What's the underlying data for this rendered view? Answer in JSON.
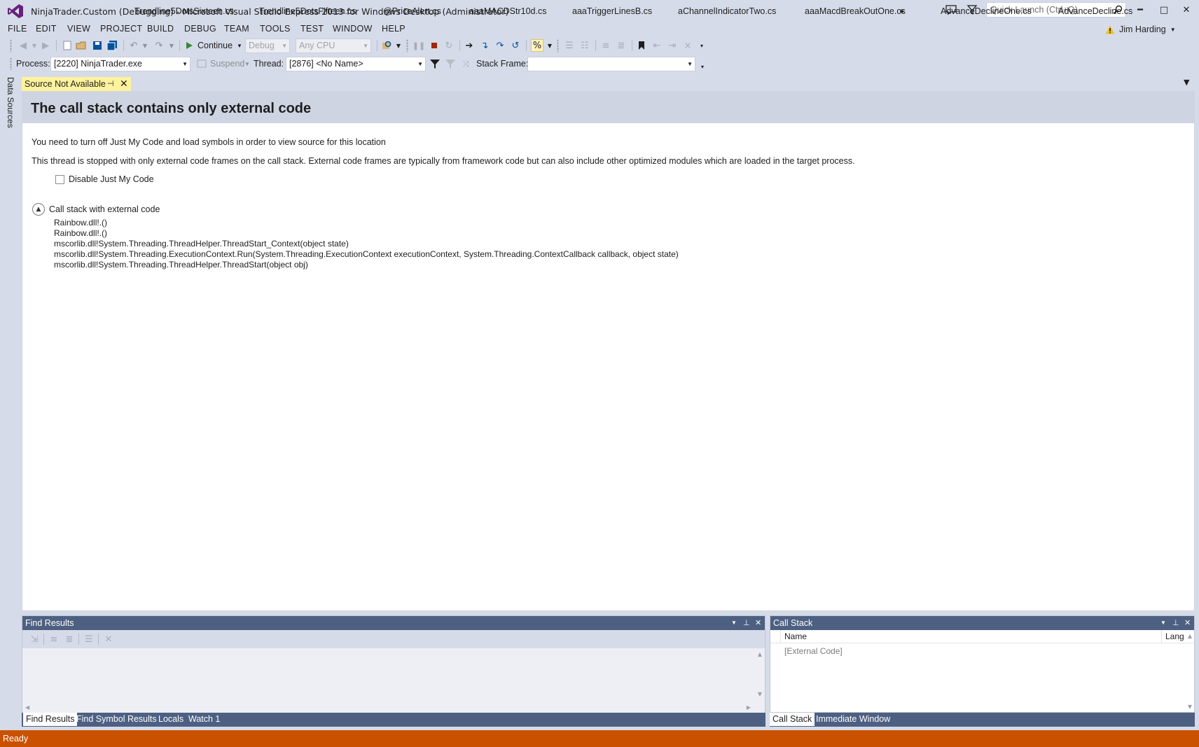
{
  "window": {
    "title": "NinjaTrader.Custom (Debugging) - Microsoft Visual Studio Express 2013 for Windows Desktop (Administrator)",
    "quick_launch_placeholder": "Quick Launch (Ctrl+Q)",
    "user_name": "Jim Harding",
    "minimize": "━",
    "maximize": "□",
    "close": "✕"
  },
  "menu": [
    "FILE",
    "EDIT",
    "VIEW",
    "PROJECT",
    "BUILD",
    "DEBUG",
    "TEAM",
    "TOOLS",
    "TEST",
    "WINDOW",
    "HELP"
  ],
  "toolbar": {
    "continue_label": "Continue",
    "config_value": "Debug",
    "platform_value": "Any CPU"
  },
  "debug_location": {
    "process_label": "Process:",
    "process_value": "[2220] NinjaTrader.exe",
    "suspend_label": "Suspend",
    "thread_label": "Thread:",
    "thread_value": "[2876] <No Name>",
    "stack_frame_label": "Stack Frame:",
    "stack_frame_value": ""
  },
  "side_tab": "Data Sources",
  "tabs": {
    "active": "Source Not Available",
    "others": [
      "Trendline5DotsSixteen.cs",
      "Trendline5DotsFifteen.cs",
      "@PriceAlert.cs",
      "aaaMACDStr10d.cs",
      "aaaTriggerLinesB.cs",
      "aChannelIndicatorTwo.cs",
      "aaaMacdBreakOutOne.cs",
      "AdvanceDeclineOne.cs",
      "AdvanceDecline.cs"
    ]
  },
  "document": {
    "title": "The call stack contains only external code",
    "para1": "You need to turn off Just My Code and load symbols in order to view source for this location",
    "para2": "This thread is stopped with only external code frames on the call stack. External code frames are typically from framework code but can also include other optimized modules which are loaded in the target process.",
    "checkbox_label": "Disable Just My Code",
    "section_label": "Call stack with external code",
    "frames": [
      "Rainbow.dll!.()",
      "Rainbow.dll!.()",
      "mscorlib.dll!System.Threading.ThreadHelper.ThreadStart_Context(object state)",
      "mscorlib.dll!System.Threading.ExecutionContext.Run(System.Threading.ExecutionContext executionContext, System.Threading.ContextCallback callback, object state)",
      "mscorlib.dll!System.Threading.ThreadHelper.ThreadStart(object obj)"
    ]
  },
  "find_results": {
    "title": "Find Results",
    "bottom_tabs": [
      "Find Results",
      "Find Symbol Results",
      "Locals",
      "Watch 1"
    ]
  },
  "call_stack": {
    "title": "Call Stack",
    "col_name": "Name",
    "col_lang": "Lang",
    "row": "[External Code]",
    "bottom_tabs": [
      "Call Stack",
      "Immediate Window"
    ]
  },
  "status": {
    "text": "Ready",
    "color": "#ca5100"
  },
  "colors": {
    "chrome": "#d6dbe9",
    "tool_header": "#4d6082",
    "active_tab": "#fff29d",
    "vs_purple": "#68217a"
  }
}
